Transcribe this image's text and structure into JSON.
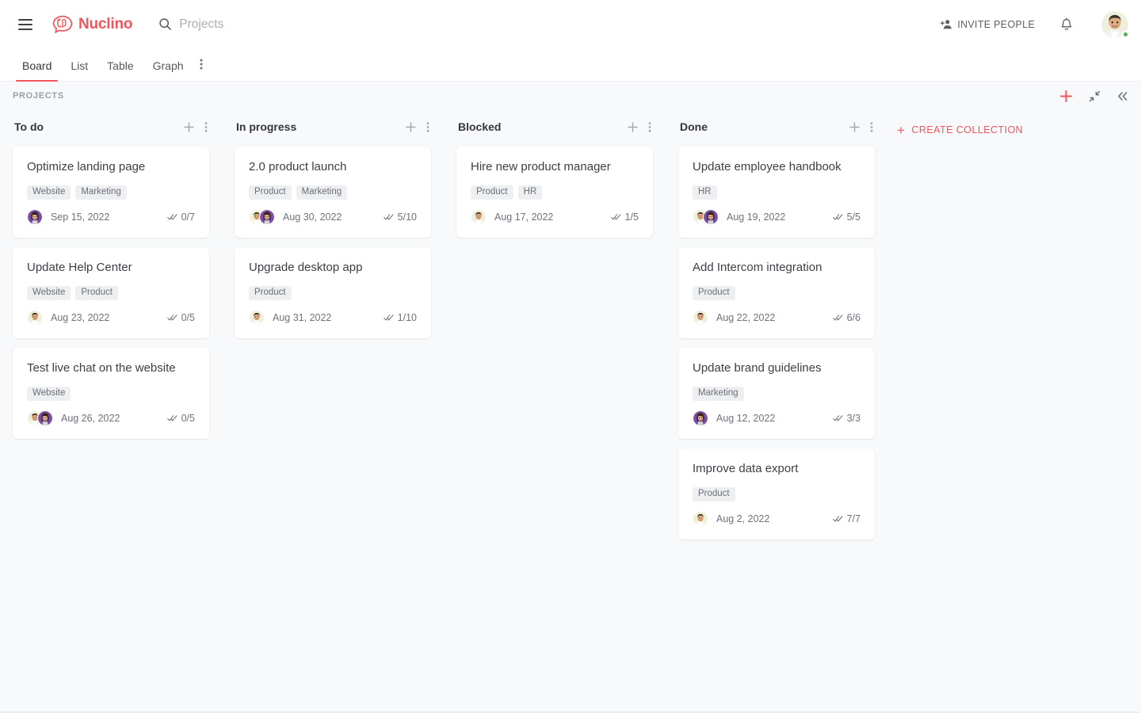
{
  "header": {
    "menu_icon": "hamburger-icon",
    "logo_icon": "nuclino-brain-logo",
    "brand_name": "Nuclino",
    "search_icon": "search-icon",
    "search_placeholder": "Projects",
    "invite_icon": "add-person-icon",
    "invite_label": "INVITE PEOPLE",
    "bell_icon": "notification-bell-icon",
    "avatar_icon": "user-avatar",
    "status": "online"
  },
  "tabs": {
    "items": [
      {
        "label": "Board",
        "active": true
      },
      {
        "label": "List",
        "active": false
      },
      {
        "label": "Table",
        "active": false
      },
      {
        "label": "Graph",
        "active": false
      }
    ],
    "more_icon": "more-vertical-icon"
  },
  "subheader": {
    "breadcrumb": "PROJECTS",
    "add_icon": "plus-icon",
    "collapse_icon": "collapse-icon",
    "sidebar_toggle_icon": "chevrons-left-icon"
  },
  "colors": {
    "accent": "#f2545b",
    "board_bg": "#f8f9fb",
    "card_bg": "#ffffff",
    "tag_bg": "#eeeff1",
    "status_green": "#4caf50"
  },
  "create_collection": {
    "label": "CREATE COLLECTION",
    "plus": "+"
  },
  "board": {
    "column_add_icon": "plus-icon",
    "column_menu_icon": "more-vertical-icon",
    "check_icon": "double-check-icon",
    "columns": [
      {
        "title": "To do",
        "cards": [
          {
            "title": "Optimize landing page",
            "tags": [
              "Website",
              "Marketing"
            ],
            "avatars": [
              "avatar-woman-purple"
            ],
            "date": "Sep 15, 2022",
            "checks": "0/7"
          },
          {
            "title": "Update Help Center",
            "tags": [
              "Website",
              "Product"
            ],
            "avatars": [
              "avatar-man-cream"
            ],
            "date": "Aug 23, 2022",
            "checks": "0/5"
          },
          {
            "title": "Test live chat on the website",
            "tags": [
              "Website"
            ],
            "avatars": [
              "avatar-man-cream",
              "avatar-woman-purple"
            ],
            "date": "Aug 26, 2022",
            "checks": "0/5"
          }
        ]
      },
      {
        "title": "In progress",
        "cards": [
          {
            "title": "2.0 product launch",
            "tags": [
              "Product",
              "Marketing"
            ],
            "avatars": [
              "avatar-man-cream",
              "avatar-woman-purple"
            ],
            "date": "Aug 30, 2022",
            "checks": "5/10"
          },
          {
            "title": "Upgrade desktop app",
            "tags": [
              "Product"
            ],
            "avatars": [
              "avatar-man-cream"
            ],
            "date": "Aug 31, 2022",
            "checks": "1/10"
          }
        ]
      },
      {
        "title": "Blocked",
        "cards": [
          {
            "title": "Hire new product manager",
            "tags": [
              "Product",
              "HR"
            ],
            "avatars": [
              "avatar-man-cream"
            ],
            "date": "Aug 17, 2022",
            "checks": "1/5"
          }
        ]
      },
      {
        "title": "Done",
        "cards": [
          {
            "title": "Update employee handbook",
            "tags": [
              "HR"
            ],
            "avatars": [
              "avatar-man-cream",
              "avatar-woman-purple"
            ],
            "date": "Aug 19, 2022",
            "checks": "5/5"
          },
          {
            "title": "Add Intercom integration",
            "tags": [
              "Product"
            ],
            "avatars": [
              "avatar-man-cream"
            ],
            "date": "Aug 22, 2022",
            "checks": "6/6"
          },
          {
            "title": "Update brand guidelines",
            "tags": [
              "Marketing"
            ],
            "avatars": [
              "avatar-woman-purple"
            ],
            "date": "Aug 12, 2022",
            "checks": "3/3"
          },
          {
            "title": "Improve data export",
            "tags": [
              "Product"
            ],
            "avatars": [
              "avatar-man-cream"
            ],
            "date": "Aug 2, 2022",
            "checks": "7/7"
          }
        ]
      }
    ]
  }
}
